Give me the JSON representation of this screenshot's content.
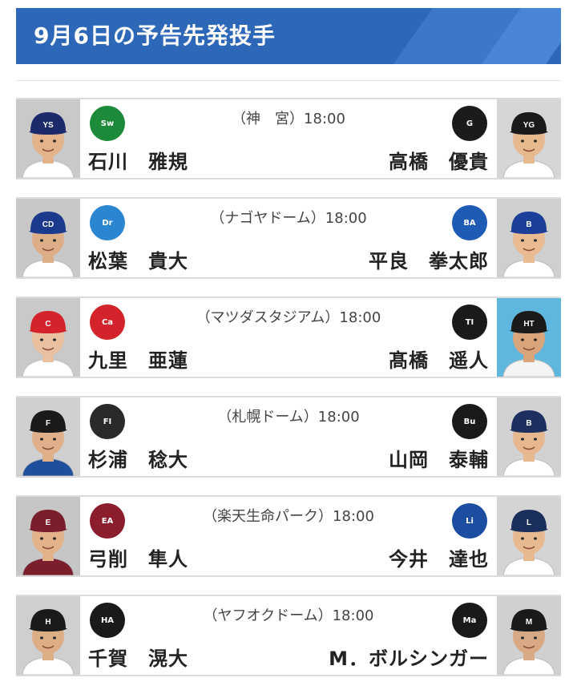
{
  "header": {
    "title": "9月6日の予告先発投手"
  },
  "games": [
    {
      "venue": "（神　宮）18:00",
      "home": {
        "pitcher": "石川　雅規",
        "team_icon": "swallows-logo-icon",
        "cap": "#1c2a6b",
        "cap_mark": "YS",
        "uniform": "#ffffff",
        "skin": "#e3b48c",
        "bg": "#c9c9c9",
        "logo_color": "#1d8a3a",
        "logo_text": "Swallows"
      },
      "away": {
        "pitcher": "高橋　優貴",
        "team_icon": "giants-logo-icon",
        "cap": "#1a1a1a",
        "cap_mark": "YG",
        "uniform": "#ffffff",
        "skin": "#e6b98f",
        "bg": "#d6d6d6",
        "logo_color": "#1b1b1b",
        "logo_text": "G"
      }
    },
    {
      "venue": "（ナゴヤドーム）18:00",
      "home": {
        "pitcher": "松葉　貴大",
        "team_icon": "dragons-logo-icon",
        "cap": "#1b3a8c",
        "cap_mark": "CD",
        "uniform": "#ffffff",
        "skin": "#dcae88",
        "bg": "#c8c8c8",
        "logo_color": "#2a86d0",
        "logo_text": "Dragons"
      },
      "away": {
        "pitcher": "平良　拳太郎",
        "team_icon": "baystars-logo-icon",
        "cap": "#1c3f9a",
        "cap_mark": "B",
        "uniform": "#ffffff",
        "skin": "#e8bb92",
        "bg": "#cfcfcf",
        "logo_color": "#1e5bb4",
        "logo_text": "BAY STARS"
      }
    },
    {
      "venue": "（マツダスタジアム）18:00",
      "home": {
        "pitcher": "九里　亜蓮",
        "team_icon": "carp-logo-icon",
        "cap": "#d4232a",
        "cap_mark": "C",
        "uniform": "#ffffff",
        "skin": "#e9c1a0",
        "bg": "#c9c9c9",
        "logo_color": "#d4232a",
        "logo_text": "Carp"
      },
      "away": {
        "pitcher": "髙橋　遥人",
        "team_icon": "tigers-logo-icon",
        "cap": "#1a1a1a",
        "cap_mark": "HT",
        "uniform": "#f4f4f4",
        "skin": "#d9a57c",
        "bg": "#5fb7dd",
        "logo_color": "#1a1a1a",
        "logo_text": "TIGERS"
      }
    },
    {
      "venue": "（札幌ドーム）18:00",
      "home": {
        "pitcher": "杉浦　稔大",
        "team_icon": "fighters-logo-icon",
        "cap": "#1a1a1a",
        "cap_mark": "F",
        "uniform": "#1e4f9c",
        "skin": "#e0b08a",
        "bg": "#d0d0d0",
        "logo_color": "#2a2a2a",
        "logo_text": "FIGHTERS"
      },
      "away": {
        "pitcher": "山岡　泰輔",
        "team_icon": "buffaloes-logo-icon",
        "cap": "#1c2f5e",
        "cap_mark": "B",
        "uniform": "#ffffff",
        "skin": "#e5b88f",
        "bg": "#d2d2d2",
        "logo_color": "#1a1a1a",
        "logo_text": "Buffaloes"
      }
    },
    {
      "venue": "（楽天生命パーク）18:00",
      "home": {
        "pitcher": "弓削　隼人",
        "team_icon": "eagles-logo-icon",
        "cap": "#7a1e2b",
        "cap_mark": "E",
        "uniform": "#7a1e2b",
        "skin": "#e2b28b",
        "bg": "#c6c6c6",
        "logo_color": "#8c1d2c",
        "logo_text": "EAGLES"
      },
      "away": {
        "pitcher": "今井　達也",
        "team_icon": "lions-logo-icon",
        "cap": "#1a2f5c",
        "cap_mark": "L",
        "uniform": "#ffffff",
        "skin": "#e6b990",
        "bg": "#d4d4d4",
        "logo_color": "#1b4ea0",
        "logo_text": "Lions"
      }
    },
    {
      "venue": "（ヤフオクドーム）18:00",
      "home": {
        "pitcher": "千賀　滉大",
        "team_icon": "hawks-logo-icon",
        "cap": "#1a1a1a",
        "cap_mark": "H",
        "uniform": "#ffffff",
        "skin": "#dcae86",
        "bg": "#cfcfcf",
        "logo_color": "#1a1a1a",
        "logo_text": "HAWKS"
      },
      "away": {
        "pitcher": "M．ボルシンガー",
        "team_icon": "marines-logo-icon",
        "cap": "#1a1a1a",
        "cap_mark": "M",
        "uniform": "#ffffff",
        "skin": "#d8a985",
        "bg": "#d0d0d0",
        "logo_color": "#1a1a1a",
        "logo_text": "Marines"
      }
    }
  ]
}
